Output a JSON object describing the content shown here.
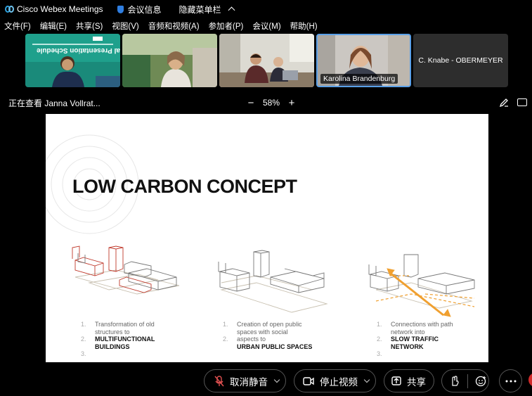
{
  "titlebar": {
    "app_title": "Cisco Webex Meetings",
    "meeting_info": "会议信息",
    "hide_menu": "隐藏菜单栏"
  },
  "menubar": {
    "items": [
      "文件(F)",
      "编辑(E)",
      "共享(S)",
      "视图(V)",
      "音频和视频(A)",
      "参加者(P)",
      "会议(M)",
      "帮助(H)"
    ]
  },
  "videos": {
    "tile5_name": "C. Knabe - OBERMEYER",
    "tile4_name": "Karolina Brandenburg",
    "tile1_text_line1": "Final Presentation Schedule"
  },
  "sharebar": {
    "viewing": "正在查看 Janna Vollrat...",
    "zoom_minus": "−",
    "zoom_value": "58%",
    "zoom_plus": "+"
  },
  "slide": {
    "title": "LOW CARBON CONCEPT",
    "captions": [
      {
        "num1": "1.",
        "line1": "Transformation of old",
        "line2": "structures to",
        "num2": "2.",
        "bold1": "MULTIFUNCTIONAL",
        "bold2": "BUILDINGS",
        "num3": "3."
      },
      {
        "num1": "1.",
        "line1": "Creation of open public",
        "line2": "spaces with social",
        "line3": "aspects to",
        "num2": "2.",
        "bold1": "URBAN PUBLIC SPACES"
      },
      {
        "num1": "1.",
        "line1": "Connections with path",
        "line2": "network into",
        "num2": "2.",
        "bold1": "SLOW TRAFFIC",
        "bold2": "NETWORK",
        "num3": "3."
      }
    ]
  },
  "toolbar": {
    "unmute": "取消静音",
    "stop_video": "停止视频",
    "share": "共享"
  },
  "colors": {
    "accent_blue": "#5aa0e8",
    "slide_red": "#c0392b",
    "slide_orange": "#f0a030",
    "end_red": "#d12a2a"
  }
}
